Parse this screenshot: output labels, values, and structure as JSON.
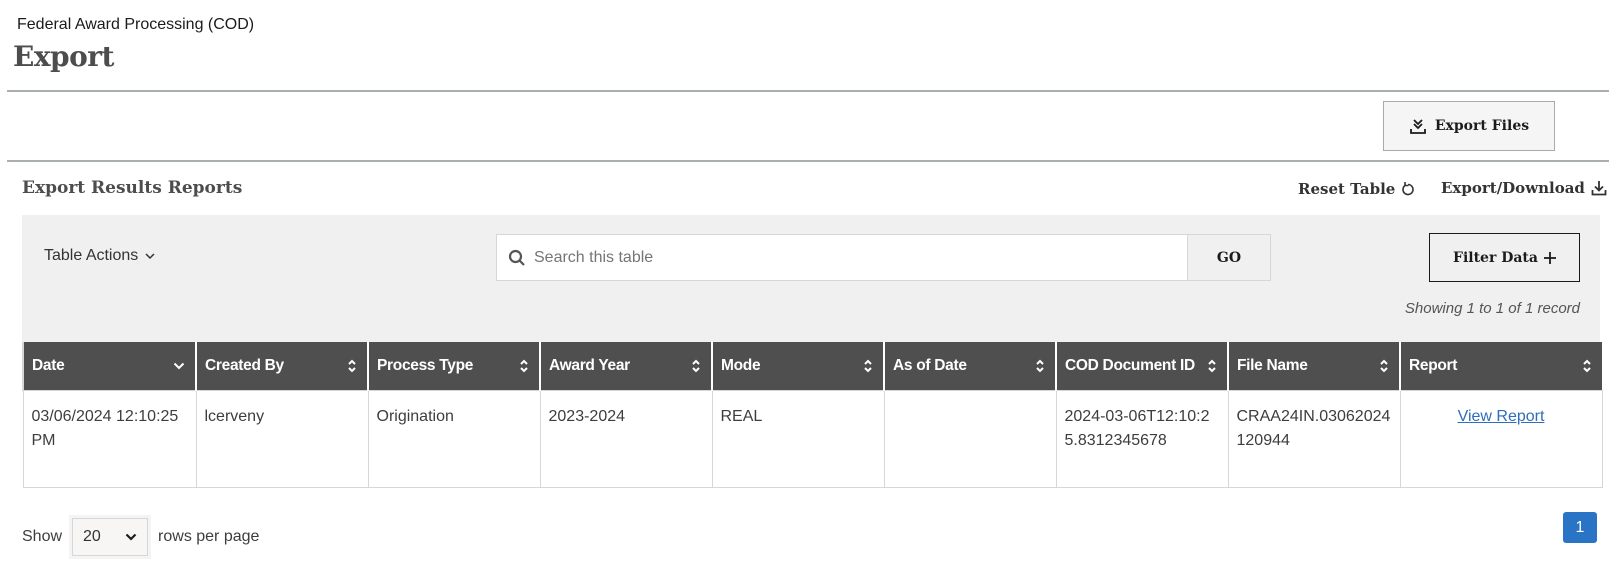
{
  "header": {
    "breadcrumb": "Federal Award Processing (COD)",
    "title": "Export"
  },
  "actions": {
    "export_files_label": "Export Files",
    "export_files_icon": "download-tray-icon"
  },
  "section": {
    "title": "Export Results Reports",
    "reset_table_label": "Reset Table",
    "reset_table_icon": "refresh-icon",
    "export_download_label": "Export/Download",
    "export_download_icon": "download-icon"
  },
  "toolbar": {
    "table_actions_label": "Table Actions",
    "search_placeholder": "Search this table",
    "search_value": "",
    "go_label": "GO",
    "filter_label": "Filter Data",
    "showing_text": "Showing 1 to 1 of 1 record"
  },
  "table": {
    "columns": [
      {
        "label": "Date",
        "sort": "desc"
      },
      {
        "label": "Created By",
        "sort": "none"
      },
      {
        "label": "Process Type",
        "sort": "none"
      },
      {
        "label": "Award Year",
        "sort": "none"
      },
      {
        "label": "Mode",
        "sort": "none"
      },
      {
        "label": "As of Date",
        "sort": "none"
      },
      {
        "label": "COD Document ID",
        "sort": "none"
      },
      {
        "label": "File Name",
        "sort": "none"
      },
      {
        "label": "Report",
        "sort": "none"
      }
    ],
    "rows": [
      {
        "date": "03/06/2024 12:10:25 PM",
        "created_by": "lcerveny",
        "process_type": "Origination",
        "award_year": "2023-2024",
        "mode": "REAL",
        "as_of_date": "",
        "cod_document_id": "2024-03-06T12:10:25.8312345678",
        "file_name": "CRAA24IN.03062024120944",
        "report_link": "View Report"
      }
    ]
  },
  "pagination": {
    "show_label": "Show",
    "rows_per_page_value": "20",
    "rows_per_page_label": "rows per page",
    "current_page": "1"
  },
  "colors": {
    "header_bg": "#4f4f4f",
    "toolbar_bg": "#f0f0f0",
    "link": "#2e6ebb",
    "page_active": "#2a74c6"
  }
}
